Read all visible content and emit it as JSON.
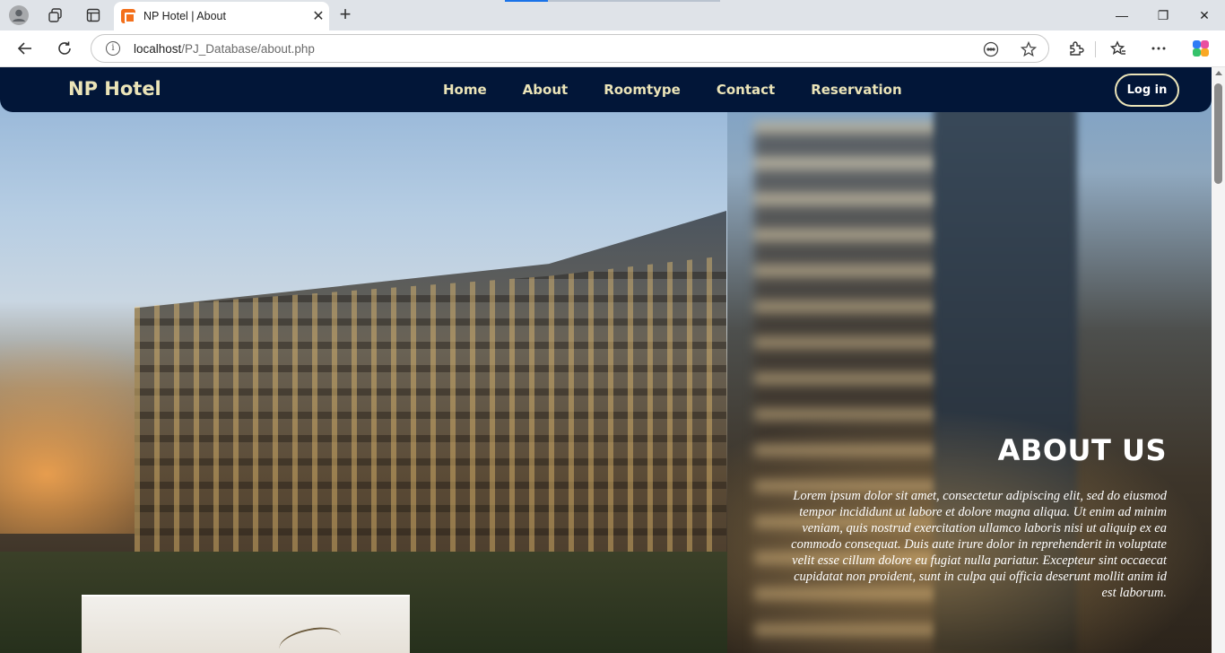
{
  "browser": {
    "tab_title": "NP Hotel | About",
    "close_tab_glyph": "✕",
    "new_tab_glyph": "+",
    "url_host": "localhost",
    "url_path": "/PJ_Database/about.php",
    "window_controls": {
      "minimize": "—",
      "restore": "❐",
      "close": "✕"
    }
  },
  "navbar": {
    "brand": "NP Hotel",
    "links": [
      "Home",
      "About",
      "Roomtype",
      "Contact",
      "Reservation"
    ],
    "login_label": "Log in"
  },
  "about": {
    "title": "ABOUT US",
    "body": "Lorem ipsum dolor sit amet, consectetur adipiscing elit, sed do eiusmod tempor incididunt ut labore et dolore magna aliqua. Ut enim ad minim veniam, quis nostrud exercitation ullamco laboris nisi ut aliquip ex ea commodo consequat. Duis aute irure dolor in reprehenderit in voluptate velit esse cillum dolore eu fugiat nulla pariatur. Excepteur sint occaecat cupidatat non proident, sunt in culpa qui officia deserunt mollit anim id est laborum."
  },
  "colors": {
    "navbar_bg": "#021638",
    "accent_text": "#ebe4b8",
    "favicon": "#f3701c"
  }
}
